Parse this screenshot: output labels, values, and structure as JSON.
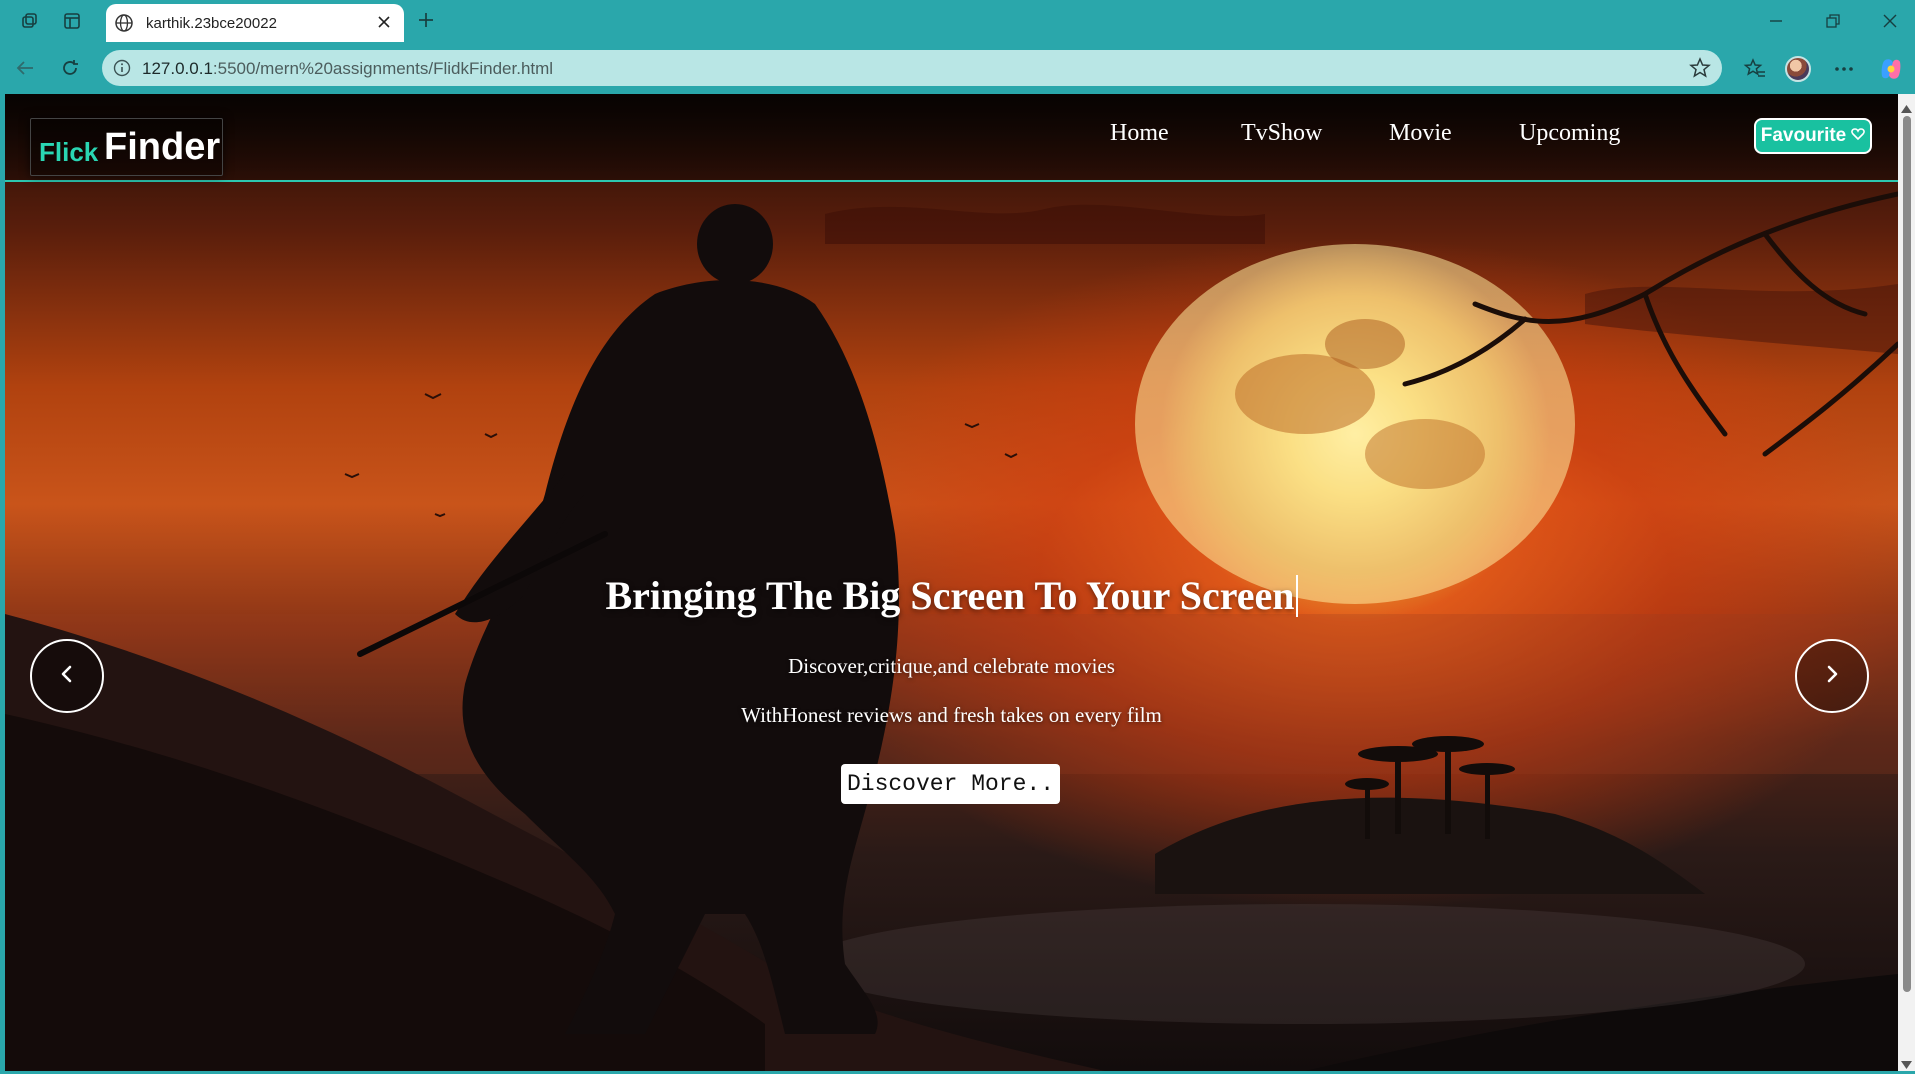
{
  "browser": {
    "tab_title": "karthik.23bce20022",
    "url_host": "127.0.0.1",
    "url_rest": ":5500/mern%20assignments/FlidkFinder.html"
  },
  "site": {
    "logo_part1": "Flick",
    "logo_part2": "Finder",
    "nav": [
      "Home",
      "TvShow",
      "Movie",
      "Upcoming"
    ],
    "favourite_label": "Favourite"
  },
  "hero": {
    "title": "Bringing The Big Screen To Your Screen",
    "line1": "Discover,critique,and celebrate movies",
    "line2": "WithHonest reviews and fresh takes on every film",
    "button_label": "Discover More.."
  },
  "colors": {
    "accent": "#19c1a0",
    "logo_green": "#2ad6b3",
    "chrome": "#2aa7ab"
  },
  "icons": [
    "workspaces-icon",
    "tab-actions-icon",
    "globe-icon",
    "close-tab-icon",
    "new-tab-icon",
    "minimize-icon",
    "restore-icon",
    "close-window-icon",
    "back-icon",
    "refresh-icon",
    "info-icon",
    "favorite-star-icon",
    "favorites-icon",
    "profile-avatar",
    "more-icon",
    "copilot-icon",
    "heart-icon",
    "chevron-left-icon",
    "chevron-right-icon"
  ]
}
